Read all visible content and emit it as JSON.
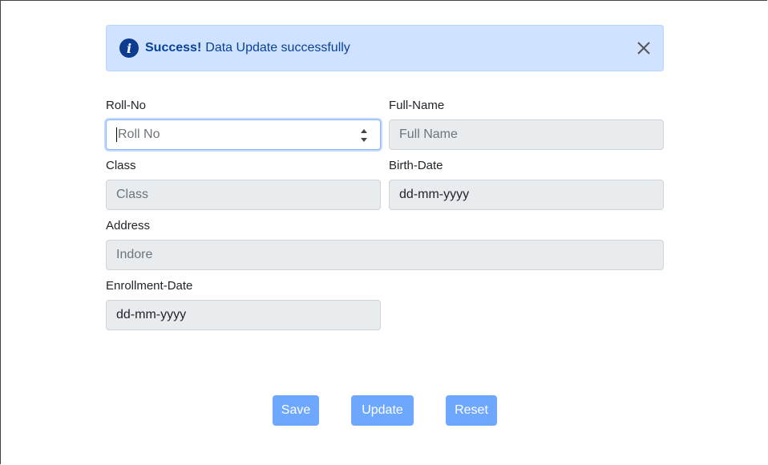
{
  "alert": {
    "icon": "info-icon",
    "title": "Success!",
    "message": "Data Update successfully",
    "close_icon": "close-icon"
  },
  "form": {
    "roll_no": {
      "label": "Roll-No",
      "placeholder": "Roll No",
      "value": ""
    },
    "full_name": {
      "label": "Full-Name",
      "placeholder": "Full Name",
      "value": ""
    },
    "class": {
      "label": "Class",
      "placeholder": "Class",
      "value": ""
    },
    "birth_date": {
      "label": "Birth-Date",
      "value": "dd-mm-yyyy"
    },
    "address": {
      "label": "Address",
      "placeholder": "Indore",
      "value": ""
    },
    "enrollment_date": {
      "label": "Enrollment-Date",
      "value": "dd-mm-yyyy"
    }
  },
  "buttons": {
    "save": "Save",
    "update": "Update",
    "reset": "Reset"
  },
  "colors": {
    "alert_bg": "#cfe2ff",
    "alert_text": "#084298",
    "button_bg": "#6ea8fe",
    "disabled_input_bg": "#e9ecef"
  }
}
